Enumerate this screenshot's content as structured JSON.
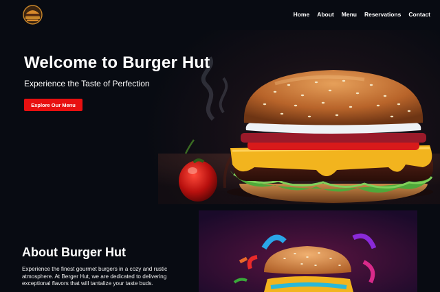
{
  "brand": {
    "logo_icon": "burger-hut-logo-icon",
    "logo_alt": "Burger Hut logo"
  },
  "nav": {
    "items": [
      {
        "label": "Home"
      },
      {
        "label": "About"
      },
      {
        "label": "Menu"
      },
      {
        "label": "Reservations"
      },
      {
        "label": "Contact"
      }
    ]
  },
  "hero": {
    "title": "Welcome to Burger Hut",
    "subtitle": "Experience the Taste of Perfection",
    "cta_label": "Explore Our Menu",
    "image_alt": "Gourmet burger with cheese, lettuce and tomato next to a red chili pepper"
  },
  "about": {
    "title": "About Burger Hut",
    "text": "Experience the finest gourmet burgers in a cozy and rustic atmosphere. At Berger Hut, we are dedicated to delivering exceptional flavors that will tantalize your taste buds.",
    "image_alt": "Colorful burger surrounded by flying ingredients"
  },
  "colors": {
    "background": "#080b12",
    "accent": "#e81010",
    "text": "#ffffff"
  }
}
